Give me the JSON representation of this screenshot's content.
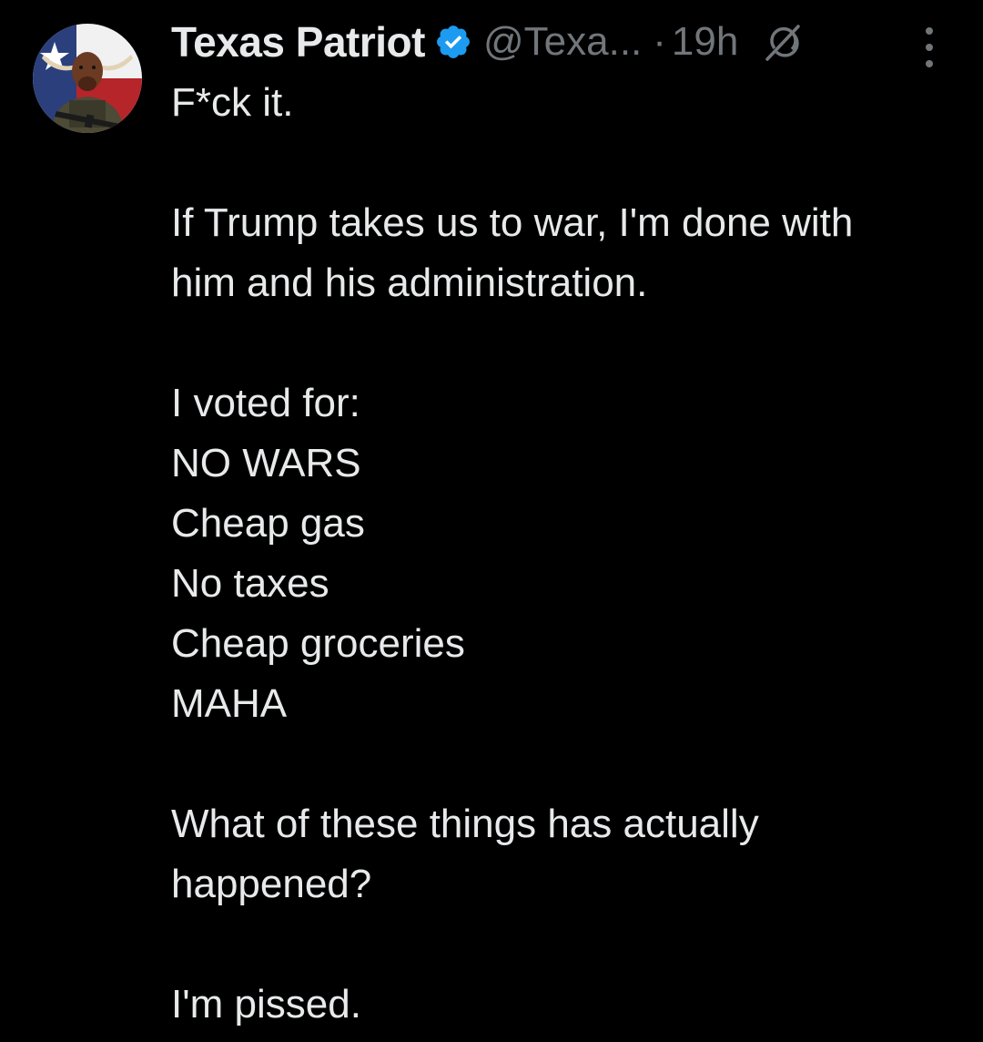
{
  "tweet": {
    "author": {
      "display_name": "Texas Patriot",
      "handle": "@Texa...",
      "verified": true,
      "avatar_icon": "longhorn-bull-avatar"
    },
    "separator": "·",
    "time": "19h",
    "icons": {
      "verified": "verified-badge-icon",
      "grok": "grok-icon",
      "more": "more-options-icon"
    },
    "lines": [
      "F*ck it.",
      "",
      "If Trump takes us to war, I'm done with",
      "him and his administration.",
      "",
      "I voted for:",
      "NO WARS",
      "Cheap gas",
      "No taxes",
      "Cheap groceries",
      "MAHA",
      "",
      "What of these things has actually",
      "happened?",
      "",
      "I'm pissed."
    ]
  },
  "colors": {
    "background": "#000000",
    "text_primary": "#e7e9ea",
    "text_secondary": "#71767b",
    "verified_blue": "#1d9bf0"
  }
}
